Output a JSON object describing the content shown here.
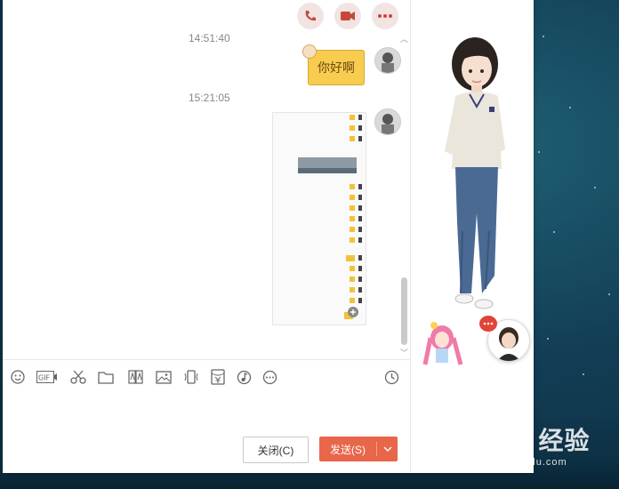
{
  "chat": {
    "timestamps": [
      "14:51:40",
      "15:21:05"
    ],
    "messages": [
      {
        "type": "text",
        "text": "你好啊"
      },
      {
        "type": "image"
      }
    ]
  },
  "buttons": {
    "close_label": "关闭(C)",
    "send_label": "发送(S)"
  },
  "toolbar_icons": [
    "emoji-icon",
    "gif-icon",
    "scissors-icon",
    "folder-icon",
    "font-style-icon",
    "image-icon",
    "shake-icon",
    "red-packet-icon",
    "music-icon",
    "more-icon",
    "history-clock-icon"
  ],
  "top_icons": [
    "phone-icon",
    "video-icon",
    "more-icon"
  ],
  "watermark": {
    "main": "Baid 经验",
    "sub": "jingyan.baidu.com"
  },
  "colors": {
    "accent": "#e8664a",
    "bubble": "#f8cc4e",
    "top_icon_bg": "#f1e4e2"
  }
}
